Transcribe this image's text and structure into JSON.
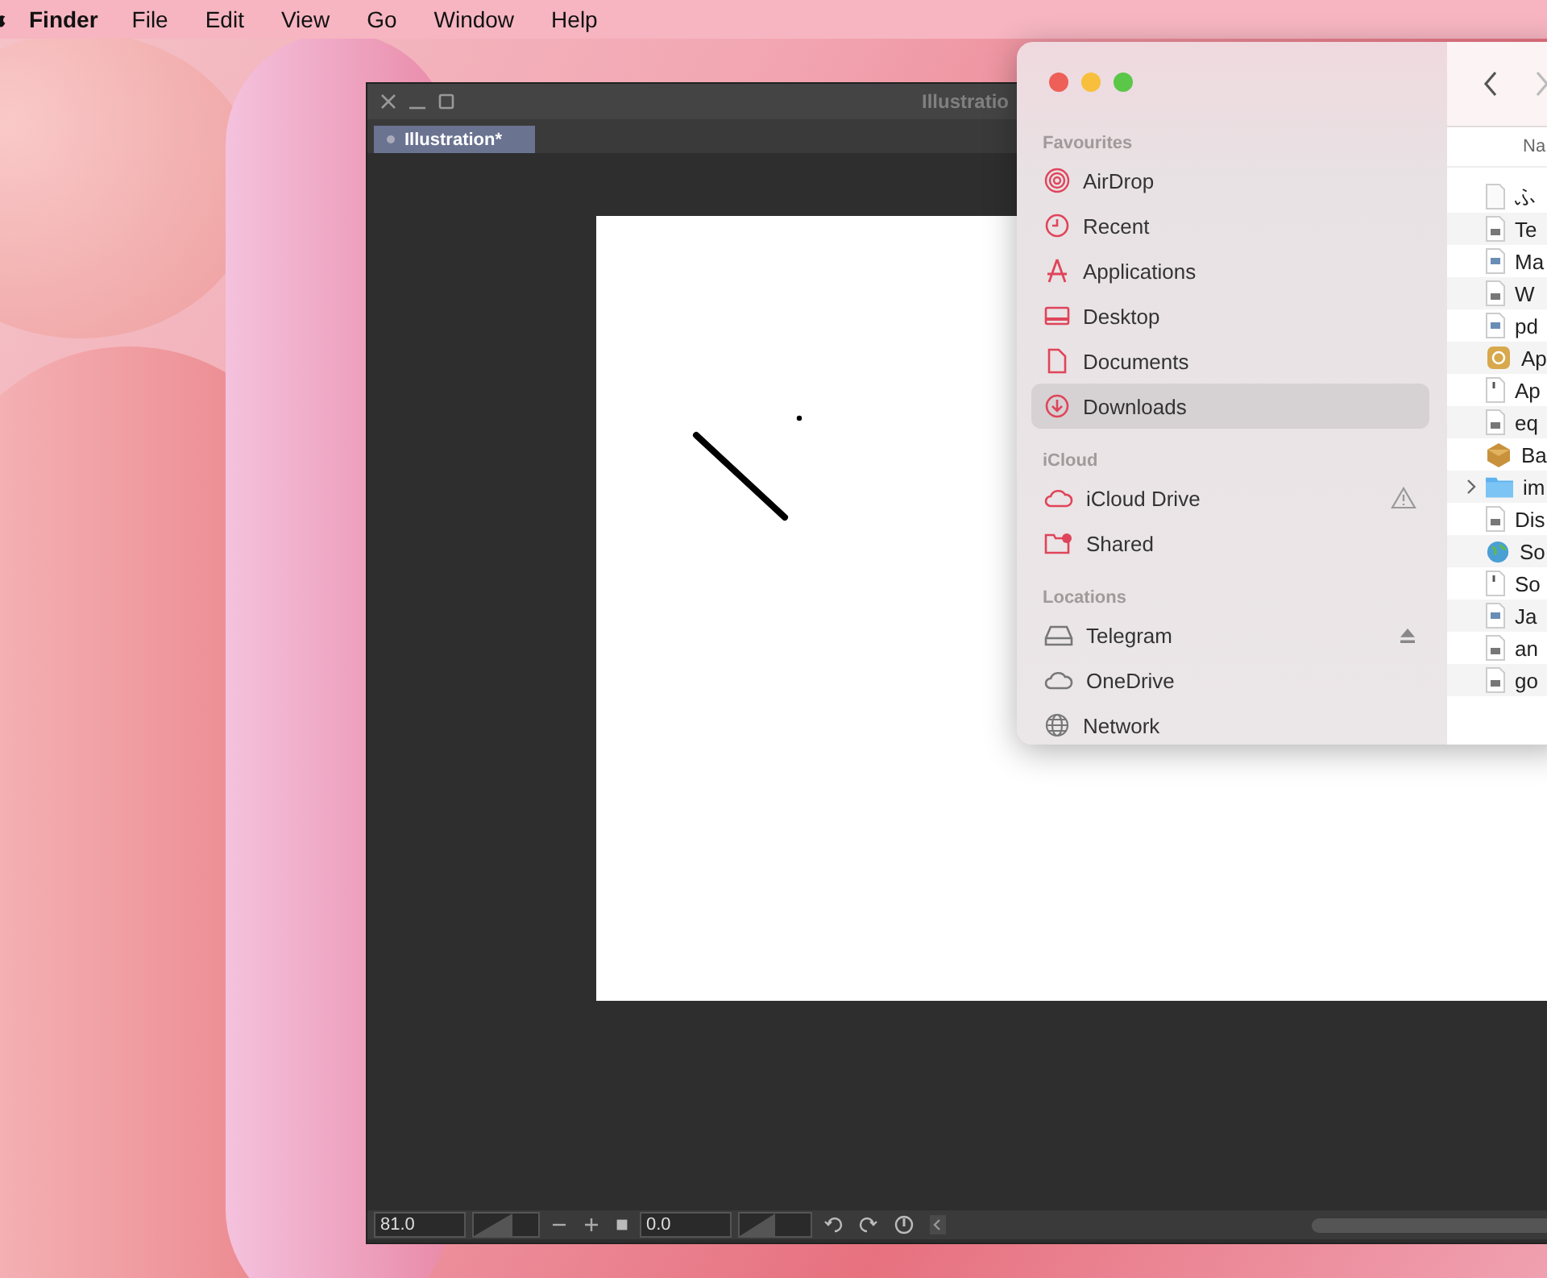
{
  "menu_bar": {
    "app_name": "Finder",
    "items": [
      "File",
      "Edit",
      "View",
      "Go",
      "Window",
      "Help"
    ]
  },
  "illustration_window": {
    "title": "Illustratio",
    "tabs": [
      {
        "label": "Illustration*",
        "selected": true
      }
    ],
    "status_bar": {
      "zoom_value": "81.0",
      "zoom_slider": {
        "level": 0.6
      },
      "angle_value": "0.0",
      "angle_slider": {
        "level": 0.5
      }
    }
  },
  "finder": {
    "sidebar": [
      {
        "heading": "Favourites",
        "items": [
          {
            "label": "AirDrop",
            "selected": false
          },
          {
            "label": "Recent",
            "selected": false
          },
          {
            "label": "Applications",
            "selected": false
          },
          {
            "label": "Desktop",
            "selected": false
          },
          {
            "label": "Documents",
            "selected": false
          },
          {
            "label": "Downloads",
            "selected": true
          }
        ]
      },
      {
        "heading": "iCloud",
        "items": [
          {
            "label": "iCloud Drive",
            "selected": false,
            "warning": true
          },
          {
            "label": "Shared",
            "selected": false
          }
        ]
      },
      {
        "heading": "Locations",
        "items": [
          {
            "label": "Telegram",
            "selected": false,
            "ejectable": true
          },
          {
            "label": "OneDrive",
            "selected": false
          },
          {
            "label": "Network",
            "selected": false
          }
        ]
      }
    ],
    "column_header": "Na",
    "files": [
      {
        "name": "ふ",
        "kind": "blank"
      },
      {
        "name": "Te",
        "kind": "text"
      },
      {
        "name": "Ma",
        "kind": "image"
      },
      {
        "name": "W",
        "kind": "text"
      },
      {
        "name": "pd",
        "kind": "image"
      },
      {
        "name": "Ap",
        "kind": "app"
      },
      {
        "name": "Ap",
        "kind": "exec"
      },
      {
        "name": "eq",
        "kind": "text"
      },
      {
        "name": "Ba",
        "kind": "package"
      },
      {
        "name": "im",
        "kind": "folder"
      },
      {
        "name": "Dis",
        "kind": "text"
      },
      {
        "name": "So",
        "kind": "globe"
      },
      {
        "name": "So",
        "kind": "exec"
      },
      {
        "name": "Ja",
        "kind": "image"
      },
      {
        "name": "an",
        "kind": "text"
      },
      {
        "name": "go",
        "kind": "text"
      }
    ]
  }
}
